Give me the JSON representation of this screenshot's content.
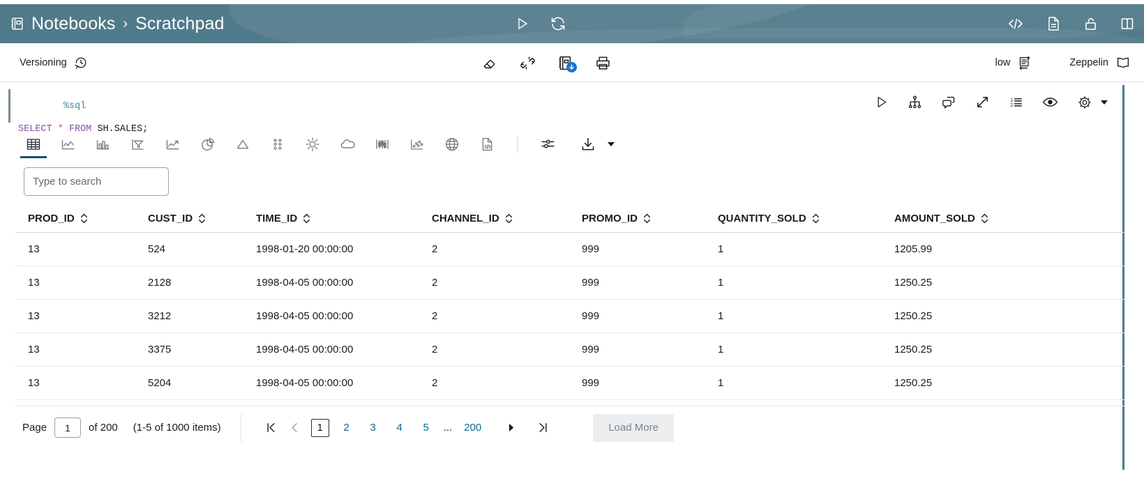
{
  "header": {
    "breadcrumb_root": "Notebooks",
    "breadcrumb_sep": "›",
    "breadcrumb_current": "Scratchpad",
    "notebook_icon": "notebook-icon",
    "center_actions": [
      {
        "name": "run-all-icon",
        "label": "Run All"
      },
      {
        "name": "refresh-icon",
        "label": "Refresh"
      }
    ],
    "right_actions": [
      {
        "name": "code-icon",
        "label": "Code"
      },
      {
        "name": "document-icon",
        "label": "Document"
      },
      {
        "name": "unlock-icon",
        "label": "Unlock"
      },
      {
        "name": "split-panel-icon",
        "label": "Split Panel"
      }
    ],
    "bar_color": "#517a8a"
  },
  "toolbar": {
    "versioning_label": "Versioning",
    "versioning_icon": "history-clock-icon",
    "center_actions": [
      {
        "name": "eraser-icon",
        "label": "Clear"
      },
      {
        "name": "disconnect-icon",
        "label": "Disconnect"
      },
      {
        "name": "notebook-download-icon",
        "label": "Save Notebook"
      },
      {
        "name": "print-icon",
        "label": "Print"
      }
    ],
    "mode_label": "low",
    "mode_icon": "text-wrap-icon",
    "engine_label": "Zeppelin",
    "engine_icon": "open-book-icon"
  },
  "editor": {
    "tokens": [
      {
        "text": "%sql",
        "type": "magic"
      },
      {
        "text": "SELECT",
        "type": "kw"
      },
      {
        "text": "*",
        "type": "op"
      },
      {
        "text": "FROM",
        "type": "kw"
      },
      {
        "text": "SH.SALES;",
        "type": "id"
      }
    ],
    "line1": "%sql",
    "line2_kw1": "SELECT",
    "line2_op": "*",
    "line2_kw2": "FROM",
    "line2_id": "SH.SALES;",
    "actions": [
      {
        "name": "run-paragraph-icon",
        "label": "Run"
      },
      {
        "name": "explain-plan-icon",
        "label": "Explain Plan"
      },
      {
        "name": "comment-icon",
        "label": "Comment"
      },
      {
        "name": "expand-icon",
        "label": "Expand"
      },
      {
        "name": "numbered-list-icon",
        "label": "Line Numbers"
      },
      {
        "name": "eye-icon",
        "label": "Show/Hide"
      },
      {
        "name": "gear-icon",
        "label": "Settings"
      }
    ]
  },
  "viz_toolbar": {
    "items": [
      {
        "name": "table-viz-icon",
        "label": "Table",
        "active": true
      },
      {
        "name": "line-chart-icon",
        "label": "Line",
        "active": false
      },
      {
        "name": "bar-chart-icon",
        "label": "Bar",
        "active": false
      },
      {
        "name": "funnel-chart-icon",
        "label": "Funnel",
        "active": false
      },
      {
        "name": "area-chart-icon",
        "label": "Area",
        "active": false
      },
      {
        "name": "pie-chart-icon",
        "label": "Pie",
        "active": false
      },
      {
        "name": "pyramid-chart-icon",
        "label": "Pyramid",
        "active": false
      },
      {
        "name": "dot-matrix-icon",
        "label": "Dot Matrix",
        "active": false
      },
      {
        "name": "sunburst-chart-icon",
        "label": "Sunburst",
        "active": false
      },
      {
        "name": "word-cloud-icon",
        "label": "Word Cloud",
        "active": false
      },
      {
        "name": "candlestick-chart-icon",
        "label": "Candlestick",
        "active": false
      },
      {
        "name": "scatter-chart-icon",
        "label": "Scatter",
        "active": false
      },
      {
        "name": "map-globe-icon",
        "label": "Map",
        "active": false
      },
      {
        "name": "raw-code-icon",
        "label": "Raw",
        "active": false
      }
    ],
    "settings_icon": "sliders-icon",
    "download_icon": "download-icon",
    "download_caret": "download-caret-icon"
  },
  "search": {
    "placeholder": "Type to search",
    "value": ""
  },
  "table": {
    "columns": [
      "PROD_ID",
      "CUST_ID",
      "TIME_ID",
      "CHANNEL_ID",
      "PROMO_ID",
      "QUANTITY_SOLD",
      "AMOUNT_SOLD"
    ],
    "rows": [
      [
        "13",
        "524",
        "1998-01-20 00:00:00",
        "2",
        "999",
        "1",
        "1205.99"
      ],
      [
        "13",
        "2128",
        "1998-04-05 00:00:00",
        "2",
        "999",
        "1",
        "1250.25"
      ],
      [
        "13",
        "3212",
        "1998-04-05 00:00:00",
        "2",
        "999",
        "1",
        "1250.25"
      ],
      [
        "13",
        "3375",
        "1998-04-05 00:00:00",
        "2",
        "999",
        "1",
        "1250.25"
      ],
      [
        "13",
        "5204",
        "1998-04-05 00:00:00",
        "2",
        "999",
        "1",
        "1250.25"
      ]
    ]
  },
  "pagination": {
    "page_label": "Page",
    "page_value": "1",
    "of_label": "of 200",
    "items_label": "(1-5 of 1000 items)",
    "first_icon": "first-page-icon",
    "prev_icon": "prev-page-icon",
    "next_icon": "next-page-icon",
    "last_icon": "last-page-icon",
    "pages": [
      "1",
      "2",
      "3",
      "4",
      "5"
    ],
    "ellipsis": "...",
    "last_page": "200",
    "current_page": "1",
    "load_more_label": "Load More",
    "link_color": "#0a6b8c"
  }
}
